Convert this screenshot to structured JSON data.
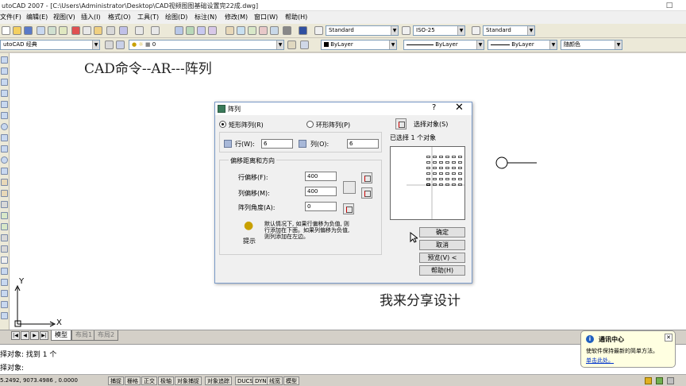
{
  "window": {
    "title": "utoCAD 2007 - [C:\\Users\\Administrator\\Desktop\\CAD视频图图基础设置完22成.dwg]",
    "maximize_glyph": "□"
  },
  "menubar": {
    "items": [
      "文件(F)",
      "编辑(E)",
      "视图(V)",
      "插入(I)",
      "格式(O)",
      "工具(T)",
      "绘图(D)",
      "标注(N)",
      "修改(M)",
      "窗口(W)",
      "帮助(H)"
    ]
  },
  "toolbar": {
    "text_style": "Standard",
    "dim_style": "ISO-25",
    "table_style": "Standard",
    "workspace": "utoCAD 经典",
    "layer": "0",
    "color": "ByLayer",
    "linetype": "ByLayer",
    "lineweight": "ByLayer",
    "plotstyle": "随颜色"
  },
  "drawing": {
    "title_text": "CAD命令--AR---阵列",
    "caption_text": "我来分享设计",
    "axis_x": "X",
    "axis_y": "Y"
  },
  "tabs": {
    "nav": [
      "|◀",
      "◀",
      "▶",
      "▶|"
    ],
    "items": [
      "模型",
      "布局1",
      "布局2"
    ]
  },
  "command_line": {
    "line1": "择对象: 找到 1 个",
    "line2": "择对象:"
  },
  "statusbar": {
    "coords": "5.2492, 9073.4986 , 0.0000",
    "modes": [
      "捕捉",
      "栅格",
      "正交",
      "极轴",
      "对象捕捉",
      "对象追踪",
      "DUCS",
      "DYN",
      "线宽",
      "模型"
    ]
  },
  "dialog": {
    "title": "阵列",
    "help": "?",
    "close": "✕",
    "radio_rect": "矩形阵列(R)",
    "radio_polar": "环形阵列(P)",
    "rows_label": "行(W):",
    "rows_value": "6",
    "cols_label": "列(O):",
    "cols_value": "6",
    "group_offset": "偏移距离和方向",
    "row_offset_label": "行偏移(F):",
    "row_offset_value": "400",
    "col_offset_label": "列偏移(M):",
    "col_offset_value": "400",
    "angle_label": "阵列角度(A):",
    "angle_value": "0",
    "tip_text_1": "默认情况下, 如果行偏移为负值, 则",
    "tip_text_2": "行添加在下面。如果列偏移为负值,",
    "tip_text_3": "则列添加在左边。",
    "tip_label": "提示",
    "select_objects": "选择对象(S)",
    "selected_count": "已选择 1 个对象",
    "ok": "确定",
    "cancel": "取消",
    "preview": "预览(V) <",
    "help_btn": "帮助(H)"
  },
  "notification": {
    "title": "通讯中心",
    "message": "使软件保持最新的简单方法。",
    "link": "单击此处。",
    "info_glyph": "i",
    "close_glyph": "✕"
  }
}
